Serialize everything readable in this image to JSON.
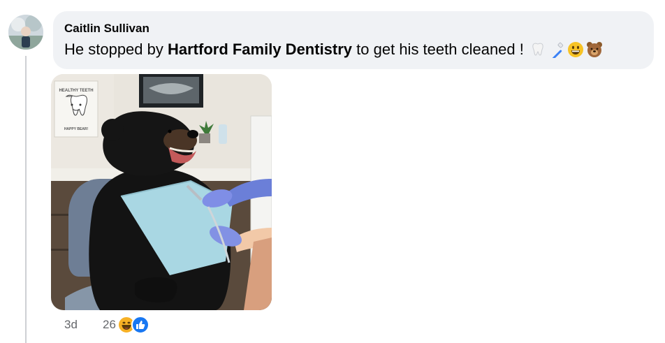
{
  "comment": {
    "author": "Caitlin Sullivan",
    "text_before": "He stopped by ",
    "text_bold": "Hartford Family Dentistry",
    "text_after": " to get his teeth cleaned !",
    "emojis": [
      "tooth-icon",
      "toothbrush-icon",
      "smiley-icon",
      "bear-face-icon"
    ]
  },
  "photo": {
    "poster_title": "HEALTHY TEETH",
    "poster_caption": "HAPPY BEAR!"
  },
  "footer": {
    "time": "3d",
    "reaction_count": "26",
    "reactions": [
      "haha-reaction-icon",
      "like-reaction-icon"
    ]
  },
  "colors": {
    "bubble_bg": "#f0f2f5",
    "secondary_text": "#65676b",
    "like_blue": "#1877f2",
    "haha_yellow": "#f7b125"
  }
}
